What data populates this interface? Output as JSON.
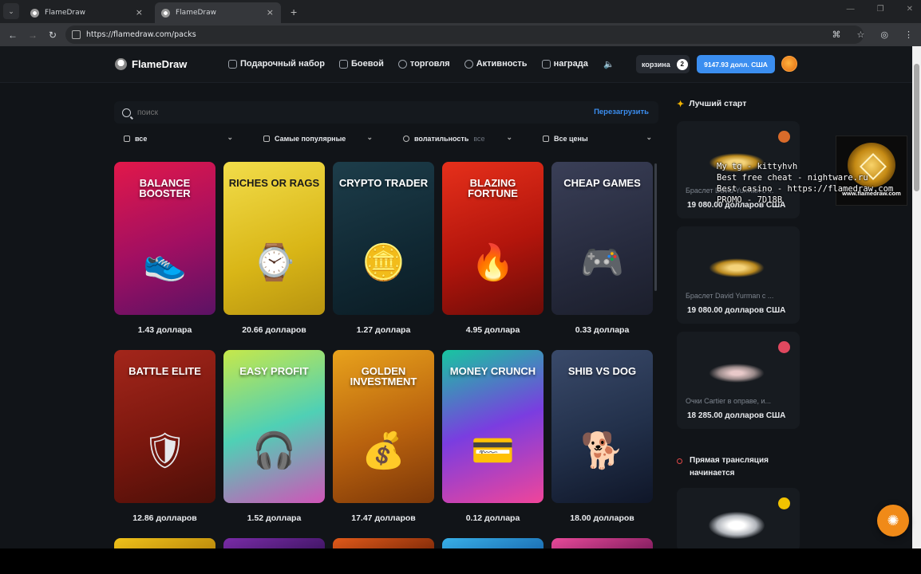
{
  "browser": {
    "tabs": [
      {
        "label": "FlameDraw"
      },
      {
        "label": "FlameDraw"
      }
    ],
    "url": "https://flamedraw.com/packs"
  },
  "header": {
    "logo": "FlameDraw",
    "nav": [
      {
        "label": "Подарочный набор",
        "icon": "gift-box-icon"
      },
      {
        "label": "Боевой",
        "icon": "swords-icon"
      },
      {
        "label": "торговля",
        "icon": "trade-icon"
      },
      {
        "label": "Активность",
        "icon": "activity-icon"
      },
      {
        "label": "награда",
        "icon": "reward-icon"
      }
    ],
    "cart_label": "корзина",
    "cart_count": "2",
    "balance": "9147.93 долл. США"
  },
  "filters": {
    "search_placeholder": "поиск",
    "reload": "Перезагрузить",
    "category": "все",
    "sort": "Самые популярные",
    "volatility": "волатильность",
    "volatility_value": "все",
    "price": "Все цены"
  },
  "packs": [
    {
      "title": "BALANCE BOOSTER",
      "price": "1.43 доллара",
      "bg": "linear-gradient(160deg,#e1184a,#a10f62 55%,#5b1264)",
      "icon": "👟"
    },
    {
      "title": "RICHES OR RAGS",
      "price": "20.66 долларов",
      "bg": "linear-gradient(160deg,#f2dd4a,#d9b617 60%,#b89410)",
      "icon": "⌚"
    },
    {
      "title": "CRYPTO TRADER",
      "price": "1.27 доллара",
      "bg": "linear-gradient(160deg,#1d3d4a,#102833 60%,#0b1c24)",
      "icon": "🪙"
    },
    {
      "title": "BLAZING FORTUNE",
      "price": "4.95 доллара",
      "bg": "linear-gradient(160deg,#e6301b,#b3150c 55%,#6a0c08)",
      "icon": "🔥"
    },
    {
      "title": "CHEAP GAMES",
      "price": "0.33 доллара",
      "bg": "linear-gradient(160deg,#3a3f57,#262a3d 60%,#1b1e2b)",
      "icon": "🎮"
    },
    {
      "title": "BATTLE ELITE",
      "price": "12.86 долларов",
      "bg": "linear-gradient(160deg,#a3261b,#7a170e 55%,#4c0f08)",
      "icon": "🛡"
    },
    {
      "title": "EASY PROFIT",
      "price": "1.52 доллара",
      "bg": "linear-gradient(160deg,#c6e84a,#4fd0b5 50%,#d054b8)",
      "icon": "🎧"
    },
    {
      "title": "GOLDEN INVESTMENT",
      "price": "17.47 долларов",
      "bg": "linear-gradient(160deg,#e8a21c,#b9620e 55%,#7c3708)",
      "icon": "💰"
    },
    {
      "title": "MONEY CRUNCH",
      "price": "0.12 доллара",
      "bg": "linear-gradient(160deg,#17c6a0,#7a3de0 50%,#f0459a)",
      "icon": "💳"
    },
    {
      "title": "SHIB VS DOG",
      "price": "18.00 долларов",
      "bg": "linear-gradient(160deg,#3a4a6a,#22304a 55%,#0f1628)",
      "icon": "🐕"
    }
  ],
  "more_packs": [
    {
      "bg": "linear-gradient(160deg,#f0c21a,#b8860b)"
    },
    {
      "bg": "linear-gradient(160deg,#7a2ca8,#3c1460)"
    },
    {
      "bg": "linear-gradient(160deg,#e05a1a,#7c2808)"
    },
    {
      "bg": "linear-gradient(160deg,#38b0e8,#1a6ab0)"
    },
    {
      "bg": "linear-gradient(160deg,#e84a9a,#7a1a5a)"
    }
  ],
  "rail": {
    "title": "Лучший старт",
    "cards": [
      {
        "name": "Браслет David Yurman с ...",
        "value": "19 080.00 долларов США",
        "badge": "#d96b2a"
      },
      {
        "name": "Браслет David Yurman с ...",
        "value": "19 080.00 долларов США",
        "badge": ""
      },
      {
        "name": "Очки Cartier в оправе, и...",
        "value": "18 285.00 долларов США",
        "badge": "#e0485f"
      },
      {
        "name": "",
        "value": "",
        "badge": "#f2c300"
      }
    ],
    "live_line1": "Прямая трансляция",
    "live_line2": "начинается"
  },
  "ad": {
    "url": "www.flamedraw.com"
  },
  "overlay": {
    "line1": "My tg - kittyhvh",
    "line2": "Best free cheat - nightware.ru",
    "line3": "Best casino - https://flamedraw.com",
    "line4": "PROMO - 7D18B"
  }
}
